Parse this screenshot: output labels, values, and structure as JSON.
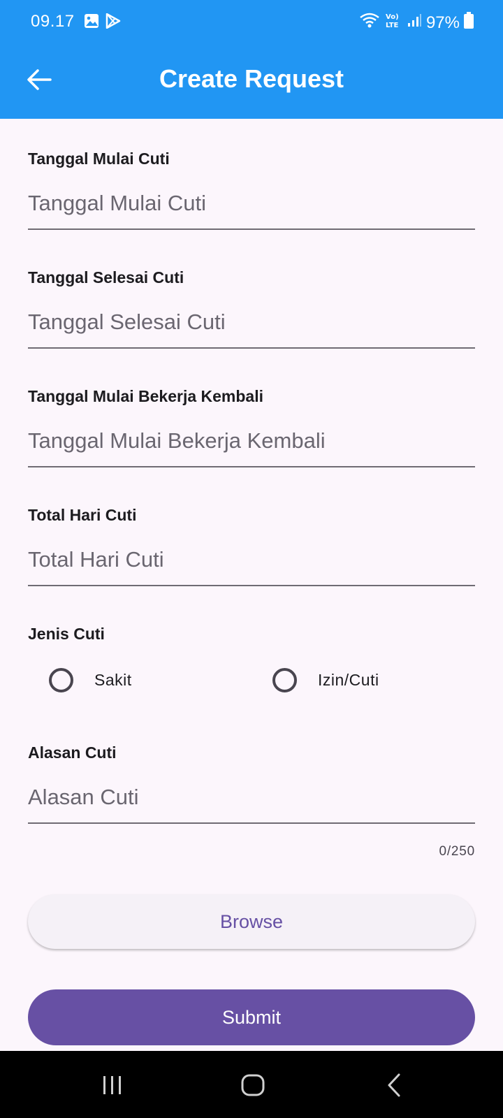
{
  "status_bar": {
    "time": "09.17",
    "battery_percent": "97%",
    "icons": [
      "gallery-icon",
      "play-store-icon",
      "wifi-icon",
      "volte-icon",
      "signal-icon",
      "battery-icon"
    ]
  },
  "app_bar": {
    "title": "Create Request",
    "back_icon": "arrow-back-icon",
    "color": "#2196f3"
  },
  "form": {
    "start_date": {
      "label": "Tanggal Mulai Cuti",
      "placeholder": "Tanggal Mulai Cuti",
      "value": ""
    },
    "end_date": {
      "label": "Tanggal Selesai Cuti",
      "placeholder": "Tanggal Selesai Cuti",
      "value": ""
    },
    "return_date": {
      "label": "Tanggal Mulai Bekerja Kembali",
      "placeholder": "Tanggal Mulai Bekerja Kembali",
      "value": ""
    },
    "total_days": {
      "label": "Total Hari Cuti",
      "placeholder": "Total Hari Cuti",
      "value": ""
    },
    "leave_type": {
      "label": "Jenis Cuti",
      "options": [
        "Sakit",
        "Izin/Cuti"
      ],
      "selected": null
    },
    "reason": {
      "label": "Alasan Cuti",
      "placeholder": "Alasan Cuti",
      "value": "",
      "counter": "0/250"
    }
  },
  "buttons": {
    "browse_label": "Browse",
    "submit_label": "Submit",
    "primary_color": "#6750a4"
  },
  "nav_bar": {
    "icons": [
      "recent-apps-icon",
      "home-icon",
      "back-nav-icon"
    ]
  }
}
